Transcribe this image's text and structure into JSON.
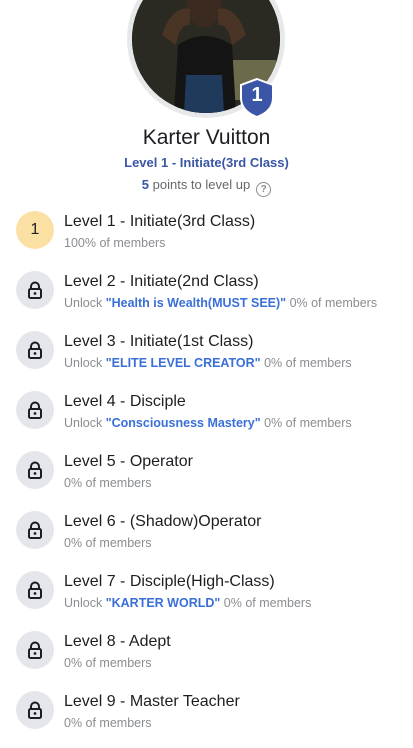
{
  "profile": {
    "name": "Karter Vuitton",
    "current_level": "Level 1 - Initiate(3rd Class)",
    "badge_number": "1",
    "points_value": "5",
    "points_suffix": " points to level up",
    "help_glyph": "?"
  },
  "levels": [
    {
      "number": "1",
      "title": "Level 1 - Initiate(3rd Class)",
      "status": "current",
      "unlock_prefix": "",
      "unlock_name": "",
      "members": "100% of members"
    },
    {
      "number": "2",
      "title": "Level 2 - Initiate(2nd Class)",
      "status": "locked",
      "unlock_prefix": "Unlock ",
      "unlock_name": "\"Health is Wealth(MUST SEE)\"",
      "members": " 0% of members"
    },
    {
      "number": "3",
      "title": "Level 3 - Initiate(1st Class)",
      "status": "locked",
      "unlock_prefix": "Unlock ",
      "unlock_name": "\"ELITE LEVEL CREATOR\"",
      "members": " 0% of members"
    },
    {
      "number": "4",
      "title": "Level 4 - Disciple",
      "status": "locked",
      "unlock_prefix": "Unlock ",
      "unlock_name": "\"Consciousness Mastery\"",
      "members": " 0% of members"
    },
    {
      "number": "5",
      "title": "Level 5 - Operator",
      "status": "locked",
      "unlock_prefix": "",
      "unlock_name": "",
      "members": "0% of members"
    },
    {
      "number": "6",
      "title": "Level 6 - (Shadow)Operator",
      "status": "locked",
      "unlock_prefix": "",
      "unlock_name": "",
      "members": "0% of members"
    },
    {
      "number": "7",
      "title": "Level 7 - Disciple(High-Class)",
      "status": "locked",
      "unlock_prefix": "Unlock ",
      "unlock_name": "\"KARTER WORLD\"",
      "members": " 0% of members"
    },
    {
      "number": "8",
      "title": "Level 8 - Adept",
      "status": "locked",
      "unlock_prefix": "",
      "unlock_name": "",
      "members": "0% of members"
    },
    {
      "number": "9",
      "title": "Level 9 - Master Teacher",
      "status": "locked",
      "unlock_prefix": "",
      "unlock_name": "",
      "members": "0% of members"
    }
  ],
  "icons": {
    "locked": "lock-icon",
    "help": "help-circle-icon",
    "badge": "shield-badge-icon"
  },
  "colors": {
    "accent_blue": "#3b56a6",
    "link_blue": "#3a6fd8",
    "current_level_bg": "#fbe0a4",
    "locked_bg": "#e4e6eb",
    "badge_blue": "#3b56a6"
  }
}
